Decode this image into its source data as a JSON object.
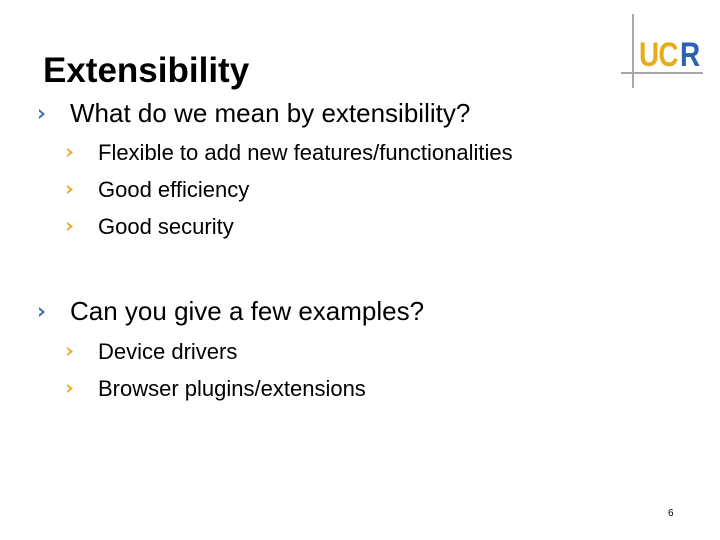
{
  "slide": {
    "title": "Extensibility",
    "page_number": "6"
  },
  "logo": {
    "text_gold": "UC",
    "text_blue": "R",
    "colors": {
      "gold": "#e6ac1c",
      "blue": "#2d62b0",
      "lines": "#a8a8a8"
    }
  },
  "bullets": [
    {
      "text": "What do we mean by extensibility?",
      "icon": "chevron-right-icon",
      "color": "#3a6ab5",
      "children": [
        {
          "text": "Flexible to add new features/functionalities",
          "icon": "chevron-right-icon",
          "color": "#e8a818"
        },
        {
          "text": "Good efficiency",
          "icon": "chevron-right-icon",
          "color": "#e8a818"
        },
        {
          "text": "Good security",
          "icon": "chevron-right-icon",
          "color": "#e8a818"
        }
      ]
    },
    {
      "text": "Can you give a few examples?",
      "icon": "chevron-right-icon",
      "color": "#3a6ab5",
      "children": [
        {
          "text": "Device drivers",
          "icon": "chevron-right-icon",
          "color": "#e8a818"
        },
        {
          "text": "Browser plugins/extensions",
          "icon": "chevron-right-icon",
          "color": "#e8a818"
        }
      ]
    }
  ]
}
